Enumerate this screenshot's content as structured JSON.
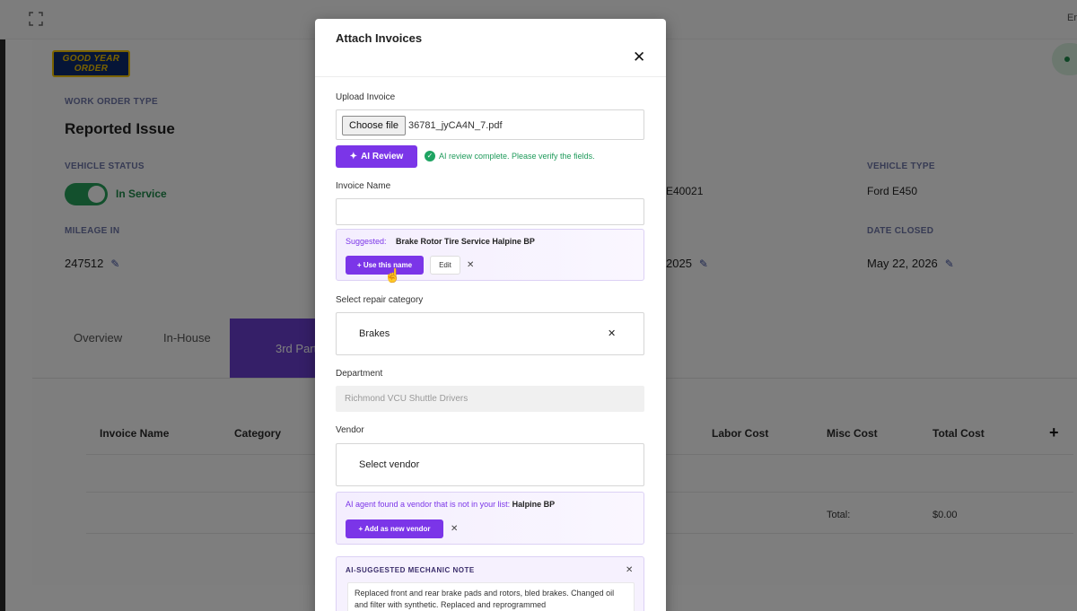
{
  "background": {
    "top_right_text": "Er",
    "logo_line1": "GOOD YEAR",
    "logo_line2": "ORDER",
    "work_order_type_label": "WORK ORDER TYPE",
    "work_order_type_value": "Reported Issue",
    "vehicle_status_label": "VEHICLE STATUS",
    "vehicle_status_value": "In Service",
    "vehicle_id_partial": "E40021",
    "vehicle_type_label": "VEHICLE TYPE",
    "vehicle_type_value": "Ford E450",
    "mileage_label": "MILEAGE IN",
    "mileage_value": "247512",
    "date_opened_partial": "2025",
    "date_closed_label": "DATE CLOSED",
    "date_closed_value": "May 22, 2026",
    "tabs": [
      "Overview",
      "In-House",
      "3rd Part"
    ],
    "table_headers": [
      "Invoice Name",
      "Category",
      "Labor Cost",
      "Misc Cost",
      "Total Cost"
    ],
    "total_label": "Total:",
    "total_value": "$0.00"
  },
  "modal": {
    "title": "Attach Invoices",
    "upload_label": "Upload Invoice",
    "choose_file_label": "Choose file",
    "file_name": "36781_jyCA4N_7.pdf",
    "ai_review_label": "AI Review",
    "ai_status": "AI review complete. Please verify the fields.",
    "invoice_name_label": "Invoice Name",
    "invoice_name_value": "",
    "suggested_label": "Suggested:",
    "suggested_value": "Brake Rotor Tire Service Halpine BP",
    "use_name_label": "+ Use this name",
    "edit_label": "Edit",
    "category_label": "Select repair category",
    "category_value": "Brakes",
    "department_label": "Department",
    "department_value": "Richmond VCU Shuttle Drivers",
    "vendor_label": "Vendor",
    "vendor_placeholder": "Select vendor",
    "vendor_found_text": "AI agent found a vendor that is not in your list:",
    "vendor_found_name": "Halpine BP",
    "add_vendor_label": "+ Add as new vendor",
    "note_title": "AI-SUGGESTED MECHANIC NOTE",
    "note_text": "Replaced front and rear brake pads and rotors, bled brakes. Changed oil and filter with synthetic. Replaced and reprogrammed"
  },
  "colors": {
    "accent": "#7b35e8",
    "success": "#1ea462",
    "tab_active": "#6a3fd1"
  }
}
